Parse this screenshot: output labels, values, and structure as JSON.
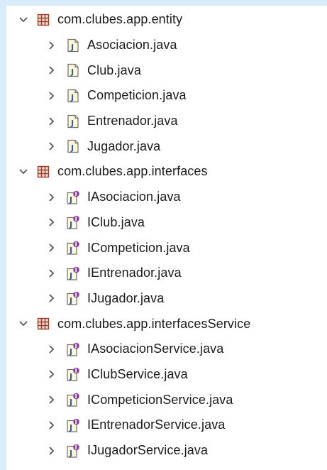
{
  "tree": {
    "packages": [
      {
        "name": "com.clubes.app.entity",
        "expanded": true,
        "icon": "package-icon",
        "files": [
          {
            "name": "Asociacion.java",
            "icon": "java-class-file-icon"
          },
          {
            "name": "Club.java",
            "icon": "java-class-file-icon"
          },
          {
            "name": "Competicion.java",
            "icon": "java-class-file-icon"
          },
          {
            "name": "Entrenador.java",
            "icon": "java-class-file-icon"
          },
          {
            "name": "Jugador.java",
            "icon": "java-class-file-icon"
          }
        ]
      },
      {
        "name": "com.clubes.app.interfaces",
        "expanded": true,
        "icon": "package-icon",
        "files": [
          {
            "name": "IAsociacion.java",
            "icon": "java-interface-file-icon"
          },
          {
            "name": "IClub.java",
            "icon": "java-interface-file-icon"
          },
          {
            "name": "ICompeticion.java",
            "icon": "java-interface-file-icon"
          },
          {
            "name": "IEntrenador.java",
            "icon": "java-interface-file-icon"
          },
          {
            "name": "IJugador.java",
            "icon": "java-interface-file-icon"
          }
        ]
      },
      {
        "name": "com.clubes.app.interfacesService",
        "expanded": true,
        "icon": "package-icon",
        "files": [
          {
            "name": "IAsociacionService.java",
            "icon": "java-interface-file-icon"
          },
          {
            "name": "IClubService.java",
            "icon": "java-interface-file-icon"
          },
          {
            "name": "ICompeticionService.java",
            "icon": "java-interface-file-icon"
          },
          {
            "name": "IEntrenadorService.java",
            "icon": "java-interface-file-icon"
          },
          {
            "name": "IJugadorService.java",
            "icon": "java-interface-file-icon"
          }
        ]
      }
    ]
  },
  "colors": {
    "background": "#d9ecfb",
    "panel": "#ffffff",
    "text": "#1a1a1a",
    "twisty": "#555555",
    "package_icon": "#9b3b2b",
    "java_file_letter": "#2a5db0",
    "interface_badge": "#8a3fa0"
  }
}
